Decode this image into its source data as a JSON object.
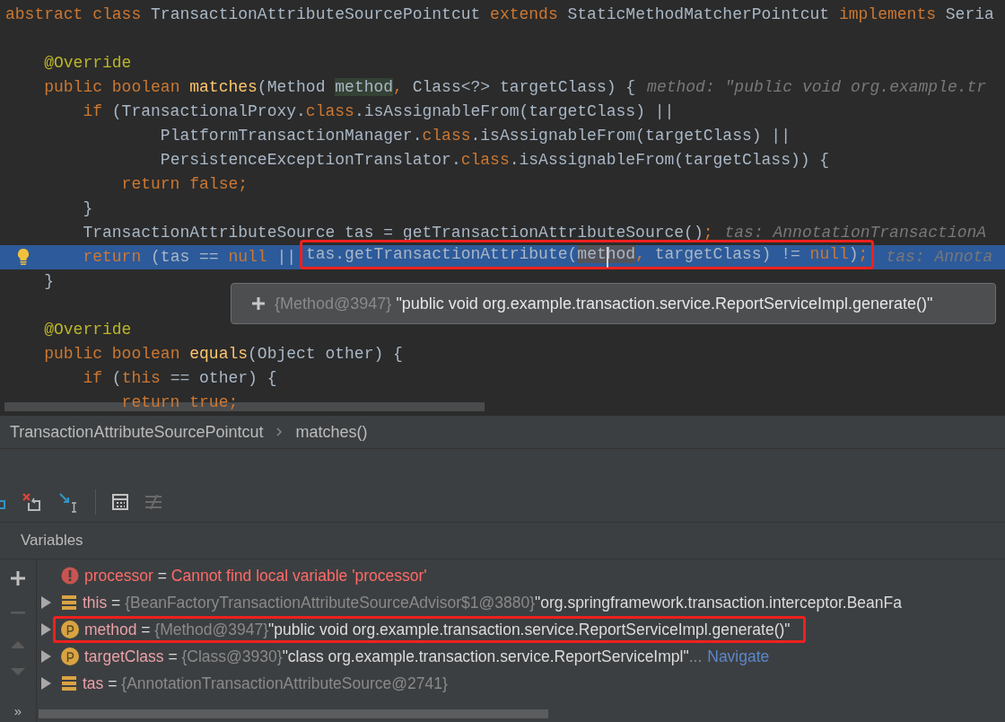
{
  "editor": {
    "lines": [
      {
        "current": false,
        "tokens": [
          {
            "kind": "kw",
            "t": "abstract class "
          },
          {
            "kind": "plain",
            "t": "TransactionAttributeSourcePointcut "
          },
          {
            "kind": "kw",
            "t": "extends "
          },
          {
            "kind": "plain",
            "t": "StaticMethodMatcherPointcut "
          },
          {
            "kind": "kw",
            "t": "implements "
          },
          {
            "kind": "plain",
            "t": "Seria"
          }
        ]
      },
      {
        "current": false
      },
      {
        "current": false,
        "tokens": [
          {
            "kind": "ann",
            "t": "    @Override"
          }
        ]
      },
      {
        "current": false,
        "tokens": [
          {
            "kind": "kw",
            "t": "    public boolean "
          },
          {
            "kind": "fn",
            "t": "matches"
          },
          {
            "kind": "plain",
            "t": "(Method "
          },
          {
            "kind": "ref",
            "t": "method"
          },
          {
            "kind": "kw",
            "t": ", "
          },
          {
            "kind": "plain",
            "t": "Class<?> targetClass) {"
          }
        ],
        "hint": "method: \"public void org.example.tr"
      },
      {
        "current": false,
        "tokens": [
          {
            "kind": "kw",
            "t": "        if "
          },
          {
            "kind": "plain",
            "t": "(TransactionalProxy."
          },
          {
            "kind": "kw",
            "t": "class"
          },
          {
            "kind": "plain",
            "t": ".isAssignableFrom(targetClass) ||"
          }
        ]
      },
      {
        "current": false,
        "tokens": [
          {
            "kind": "plain",
            "t": "                PlatformTransactionManager."
          },
          {
            "kind": "kw",
            "t": "class"
          },
          {
            "kind": "plain",
            "t": ".isAssignableFrom(targetClass) ||"
          }
        ]
      },
      {
        "current": false,
        "tokens": [
          {
            "kind": "plain",
            "t": "                PersistenceExceptionTranslator."
          },
          {
            "kind": "kw",
            "t": "class"
          },
          {
            "kind": "plain",
            "t": ".isAssignableFrom(targetClass)) {"
          }
        ]
      },
      {
        "current": false,
        "tokens": [
          {
            "kind": "kw",
            "t": "            return false;"
          }
        ]
      },
      {
        "current": false,
        "tokens": [
          {
            "kind": "plain",
            "t": "        }"
          }
        ]
      },
      {
        "current": false,
        "tokens": [
          {
            "kind": "plain",
            "t": "        TransactionAttributeSource tas = getTransactionAttributeSource()"
          },
          {
            "kind": "kw",
            "t": ";"
          }
        ],
        "hint": "tas: AnnotationTransactionA"
      },
      {
        "current": true,
        "tokens": [
          {
            "kind": "kw",
            "t": "        return "
          },
          {
            "kind": "plain",
            "t": "(tas == "
          },
          {
            "kind": "kw",
            "t": "null "
          },
          {
            "kind": "plain",
            "t": "|| "
          },
          {
            "kind": "boxed",
            "tokens": [
              {
                "kind": "plain",
                "t": "tas.getTransactionAttribute("
              },
              {
                "kind": "sel",
                "t": "method"
              },
              {
                "kind": "kw",
                "t": ", "
              },
              {
                "kind": "plain",
                "t": "targetClass) != "
              },
              {
                "kind": "kw",
                "t": "null"
              },
              {
                "kind": "plain",
                "t": ")"
              },
              {
                "kind": "kw",
                "t": ";"
              }
            ]
          }
        ],
        "hint": "tas: Annota"
      },
      {
        "current": false,
        "tokens": [
          {
            "kind": "plain",
            "t": "    }"
          }
        ]
      },
      {
        "current": false
      },
      {
        "current": false,
        "tokens": [
          {
            "kind": "ann",
            "t": "    @Override"
          }
        ]
      },
      {
        "current": false,
        "tokens": [
          {
            "kind": "kw",
            "t": "    public boolean "
          },
          {
            "kind": "fn",
            "t": "equals"
          },
          {
            "kind": "plain",
            "t": "(Object other) {"
          }
        ]
      },
      {
        "current": false,
        "tokens": [
          {
            "kind": "kw",
            "t": "        if "
          },
          {
            "kind": "plain",
            "t": "("
          },
          {
            "kind": "kw",
            "t": "this "
          },
          {
            "kind": "plain",
            "t": "== other) {"
          }
        ]
      },
      {
        "current": false,
        "tokens": [
          {
            "kind": "kw",
            "t": "            return true;"
          }
        ]
      }
    ]
  },
  "tooltip": {
    "type_ref": "{Method@3947}",
    "value": "\"public void org.example.transaction.service.ReportServiceImpl.generate()\""
  },
  "breadcrumbs": [
    "TransactionAttributeSourcePointcut",
    "matches()"
  ],
  "variables": {
    "title": "Variables",
    "more": "»",
    "rows": [
      {
        "kind": "error",
        "expandable": false,
        "highlighted": false,
        "name": "processor",
        "sep": "=",
        "message": "Cannot find local variable 'processor'"
      },
      {
        "kind": "object",
        "expandable": true,
        "highlighted": false,
        "name": "this",
        "sep": "=",
        "type_ref": "{BeanFactoryTransactionAttributeSourceAdvisor$1@3880}",
        "value": "\"org.springframework.transaction.interceptor.BeanFa"
      },
      {
        "kind": "param",
        "expandable": true,
        "highlighted": true,
        "name": "method",
        "sep": "=",
        "type_ref": "{Method@3947}",
        "value": "\"public void org.example.transaction.service.ReportServiceImpl.generate()\""
      },
      {
        "kind": "param",
        "expandable": true,
        "highlighted": false,
        "name": "targetClass",
        "sep": "=",
        "type_ref": "{Class@3930}",
        "value": "\"class org.example.transaction.service.ReportServiceImpl\"",
        "ellipsis": "...",
        "link": "Navigate"
      },
      {
        "kind": "object",
        "expandable": true,
        "highlighted": false,
        "name": "tas",
        "sep": "=",
        "type_ref": "{AnnotationTransactionAttributeSource@2741}"
      }
    ]
  }
}
